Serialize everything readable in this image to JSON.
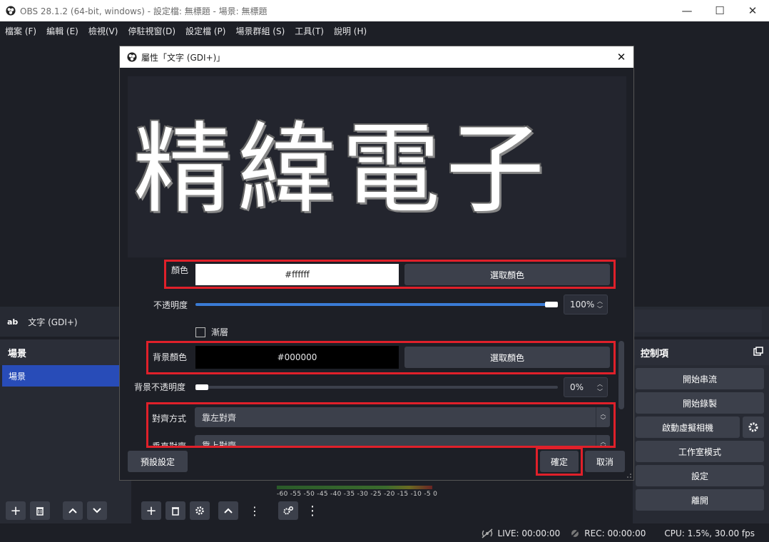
{
  "window": {
    "title": "OBS 28.1.2 (64-bit, windows) - 設定檔: 無標題 - 場景: 無標題",
    "minimize": "—",
    "maximize": "☐",
    "close": "✕"
  },
  "menu": [
    "檔案 (F)",
    "編輯 (E)",
    "檢視(V)",
    "停駐視窗(D)",
    "設定檔 (P)",
    "場景群組 (S)",
    "工具(T)",
    "說明 (H)"
  ],
  "source_strip": {
    "icon_text": "ab",
    "name": "文字 (GDI+)"
  },
  "scenes_dock": {
    "title": "場景",
    "items": [
      "場景"
    ]
  },
  "controls_dock": {
    "title": "控制項",
    "buttons": [
      "開始串流",
      "開始錄製",
      "啟動虛擬相機",
      "工作室模式",
      "設定",
      "離開"
    ]
  },
  "mixer": {
    "scale": "-60 -55 -50 -45 -40 -35 -30 -25 -20 -15 -10 -5 0"
  },
  "status": {
    "live": "LIVE: 00:00:00",
    "rec": "REC: 00:00:00",
    "cpu": "CPU: 1.5%, 30.00 fps"
  },
  "dialog": {
    "title": "屬性「文字 (GDI+)」",
    "close": "✕",
    "preview_text": "精緯電子",
    "color": {
      "label": "顏色",
      "value": "#ffffff",
      "pick": "選取顏色"
    },
    "opacity": {
      "label": "不透明度",
      "value": "100%",
      "percent": 100
    },
    "gradient": {
      "label": "漸層"
    },
    "bg_color": {
      "label": "背景顏色",
      "value": "#000000",
      "pick": "選取顏色"
    },
    "bg_opacity": {
      "label": "背景不透明度",
      "value": "0%",
      "percent": 0
    },
    "align": {
      "label": "對齊方式",
      "value": "靠左對齊"
    },
    "valign": {
      "label": "垂直對齊",
      "value": "靠上對齊"
    },
    "defaults_button": "預設設定",
    "ok_button": "確定",
    "cancel_button": "取消"
  },
  "colors": {
    "accent": "#284cb8",
    "highlight": "#e0202a",
    "slider": "#3a7bd5"
  }
}
